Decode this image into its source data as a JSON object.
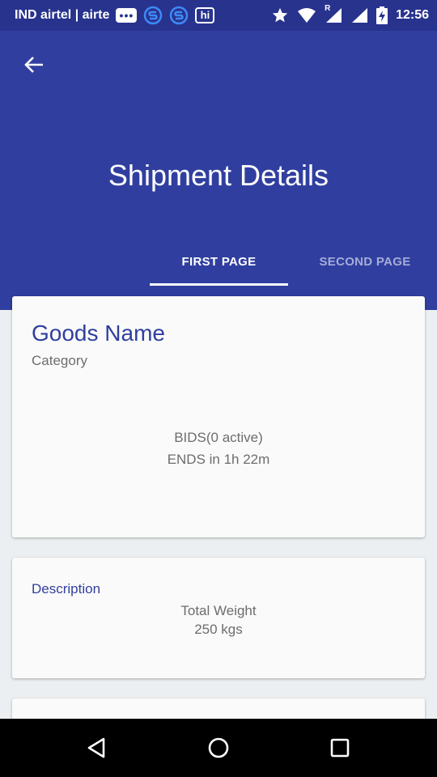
{
  "status_bar": {
    "carrier": "IND airtel | airte",
    "notification_icons": [
      "message-icon",
      "s-app-icon",
      "s-app-icon",
      "hi-app-icon"
    ],
    "hi_badge": "hi",
    "status_icons": [
      "star-icon",
      "wifi-icon",
      "signal-roaming-icon",
      "signal-icon",
      "battery-charging-icon"
    ],
    "roaming_letter": "R",
    "time": "12:56"
  },
  "app_bar": {
    "title": "Shipment Details",
    "tabs": [
      {
        "label": "FIRST PAGE",
        "selected": true
      },
      {
        "label": "SECOND PAGE",
        "selected": false
      }
    ]
  },
  "shipment_card": {
    "goods_name": "Goods Name",
    "category": "Category",
    "bids": "BIDS(0 active)",
    "ends": "ENDS in 1h 22m"
  },
  "description_card": {
    "label": "Description",
    "weight_label": "Total Weight",
    "weight_value": "250 kgs"
  },
  "colors": {
    "status_bar": "#28338e",
    "primary": "#303f9f",
    "background": "#eceff1",
    "card": "#fafafa",
    "secondary_text": "#6d6d6d",
    "inactive_tab": "#a5acd9"
  },
  "nav_bar": {
    "buttons": [
      "back-triangle-icon",
      "home-circle-icon",
      "recents-square-icon"
    ]
  }
}
